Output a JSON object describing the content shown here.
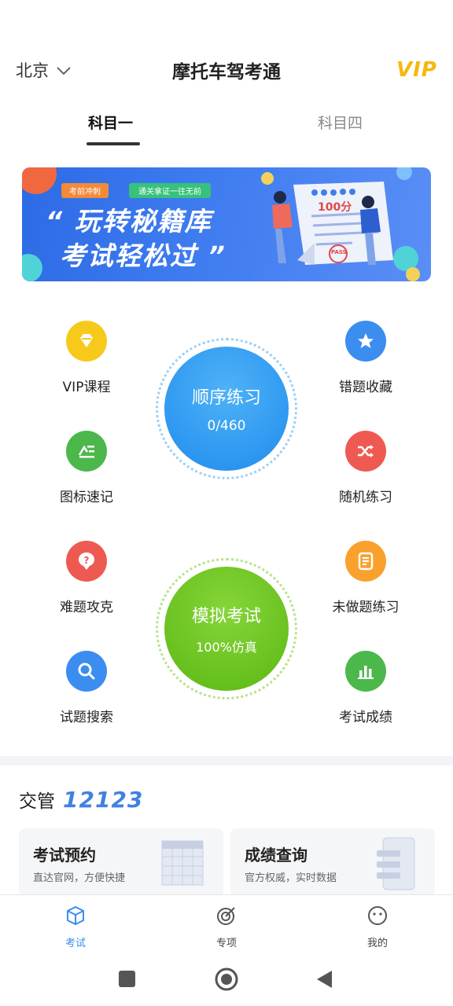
{
  "header": {
    "city": "北京",
    "title": "摩托车驾考通",
    "vip": "VIP"
  },
  "tabs": [
    {
      "label": "科目一",
      "active": true
    },
    {
      "label": "科目四",
      "active": false
    }
  ],
  "banner": {
    "tag1": "考前冲刺",
    "tag2": "通关拿证一往无前",
    "slogan_line1": "“ 玩转秘籍库",
    "slogan_line2": "考试轻松过 ”",
    "score": "100分",
    "stamp": "PASS"
  },
  "features": {
    "left": [
      {
        "label": "VIP课程",
        "icon": "diamond-icon",
        "color": "#f7c91b"
      },
      {
        "label": "图标速记",
        "icon": "list-icon",
        "color": "#4cb84b"
      },
      {
        "label": "难题攻克",
        "icon": "question-icon",
        "color": "#ee5a52"
      },
      {
        "label": "试题搜索",
        "icon": "search-icon",
        "color": "#3b8df0"
      }
    ],
    "right": [
      {
        "label": "错题收藏",
        "icon": "star-icon",
        "color": "#3b8df0"
      },
      {
        "label": "随机练习",
        "icon": "shuffle-icon",
        "color": "#ee5a52"
      },
      {
        "label": "未做题练习",
        "icon": "document-icon",
        "color": "#f9a12c"
      },
      {
        "label": "考试成绩",
        "icon": "bar-chart-icon",
        "color": "#4cb84b"
      }
    ]
  },
  "sequential_practice": {
    "label": "顺序练习",
    "progress": "0/460",
    "color": "#2f9af2"
  },
  "mock_exam": {
    "label": "模拟考试",
    "subtitle": "100%仿真",
    "color": "#6cc71f"
  },
  "traffic_section": {
    "title": "交管",
    "number": "12123",
    "cards": [
      {
        "title": "考试预约",
        "subtitle": "直达官网，方便快捷"
      },
      {
        "title": "成绩查询",
        "subtitle": "官方权威，实时数据"
      }
    ]
  },
  "bottom_nav": [
    {
      "label": "考试",
      "icon": "cube-icon",
      "active": true
    },
    {
      "label": "专项",
      "icon": "target-icon",
      "active": false
    },
    {
      "label": "我的",
      "icon": "face-icon",
      "active": false
    }
  ],
  "accent_color": "#3b8df0"
}
